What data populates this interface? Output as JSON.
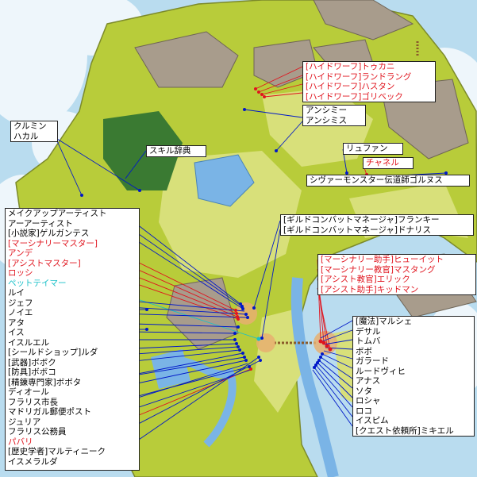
{
  "colors": {
    "ocean": "#b9dcef",
    "land": "#b8cc3a",
    "lowland": "#d8e07a",
    "mountain": "#a89c8c",
    "forest": "#3a7a32",
    "lake": "#7ab4e6",
    "river": "#7ab4e6",
    "line_blue": "#0018c8",
    "line_red": "#e0141e",
    "line_cyan": "#18c0c8",
    "town": "#e8b070"
  },
  "labels": {
    "dwarves": [
      {
        "text": "[ハイドワーフ]トゥカニ",
        "color": "red"
      },
      {
        "text": "[ハイドワーフ]ランドラング",
        "color": "red"
      },
      {
        "text": "[ハイドワーフ]ハスタン",
        "color": "red"
      },
      {
        "text": "[ハイドワーフ]ゴリベック",
        "color": "red"
      }
    ],
    "anshimi": [
      "アンシミー",
      "アンシミス"
    ],
    "crumin": [
      "クルミン",
      "ハカル"
    ],
    "skill_dict": "スキル辞典",
    "ryufan": {
      "text": "リュファン",
      "color": "blue"
    },
    "chaneru": {
      "text": "チャネル",
      "color": "red"
    },
    "golnus": "シヴァーモンスター伝道師ゴルヌス",
    "guild": [
      "[ギルドコンバットマネージャ]フランキー",
      "[ギルドコンバットマネージャ]ドナリス"
    ],
    "mercenary": [
      {
        "text": "[マーシナリー助手]ヒューイット",
        "color": "red"
      },
      {
        "text": "[マーシナリー教官]マスタング",
        "color": "red"
      },
      {
        "text": "[アシスト教官]エリック",
        "color": "red"
      },
      {
        "text": "[アシスト助手]キッドマン",
        "color": "red"
      }
    ],
    "west_npcs": [
      {
        "text": "メイクアップアーティスト",
        "color": "blue"
      },
      {
        "text": "アーアーティスト",
        "color": "blue"
      },
      {
        "text": "[小説家]ゲルガンテス",
        "color": "blue"
      },
      {
        "text": "[マーシナリーマスター]",
        "color": "red"
      },
      {
        "text": "アンデ",
        "color": "red"
      },
      {
        "text": "[アシストマスター]",
        "color": "red"
      },
      {
        "text": "ロッシ",
        "color": "red"
      },
      {
        "text": "ペットテイマー",
        "color": "cyan"
      },
      {
        "text": "ルイ",
        "color": "blue"
      },
      {
        "text": "ジェフ",
        "color": "blue"
      },
      {
        "text": "ノイエ",
        "color": "blue"
      },
      {
        "text": "アタ",
        "color": "blue"
      },
      {
        "text": "イス",
        "color": "blue"
      },
      {
        "text": "イスルエル",
        "color": "blue"
      },
      {
        "text": "[シールドショップ]ルダ",
        "color": "blue"
      },
      {
        "text": "[武器]ボボク",
        "color": "blue"
      },
      {
        "text": "[防具]ボボコ",
        "color": "blue"
      },
      {
        "text": "[精錬専門家]ボボタ",
        "color": "blue"
      },
      {
        "text": "ディオール",
        "color": "blue"
      },
      {
        "text": "フラリス市長",
        "color": "blue"
      },
      {
        "text": "マドリガル郵便ポスト",
        "color": "blue"
      },
      {
        "text": "ジュリア",
        "color": "blue"
      },
      {
        "text": "フラリス公務員",
        "color": "blue"
      },
      {
        "text": "パバリ",
        "color": "red"
      },
      {
        "text": "[歴史学者]マルティニーク",
        "color": "blue"
      },
      {
        "text": "イスメラルダ",
        "color": "blue"
      }
    ],
    "east_npcs": [
      "[魔法]マルシェ",
      "デサル",
      "トムバ",
      "ボボ",
      "ガラード",
      "ルードヴィヒ",
      "アナス",
      "ソタ",
      "ロシャ",
      "ロコ",
      "イスピム",
      "[クエスト依頼所]ミキエル"
    ]
  }
}
